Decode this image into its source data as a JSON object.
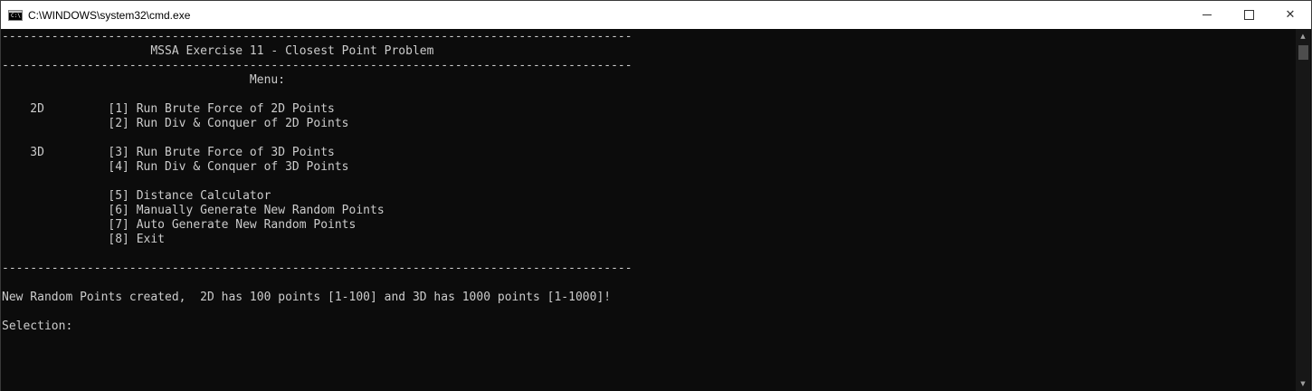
{
  "window": {
    "title": "C:\\WINDOWS\\system32\\cmd.exe",
    "icon": "cmd-icon",
    "controls": {
      "minimize_icon": "minimize-icon",
      "maximize_icon": "maximize-icon",
      "close_label": "✕"
    }
  },
  "console": {
    "lines": [
      "-----------------------------------------------------------------------------------------",
      "                     MSSA Exercise 11 - Closest Point Problem",
      "-----------------------------------------------------------------------------------------",
      "                                   Menu:",
      "",
      "    2D         [1] Run Brute Force of 2D Points",
      "               [2] Run Div & Conquer of 2D Points",
      "",
      "    3D         [3] Run Brute Force of 3D Points",
      "               [4] Run Div & Conquer of 3D Points",
      "",
      "               [5] Distance Calculator",
      "               [6] Manually Generate New Random Points",
      "               [7] Auto Generate New Random Points",
      "               [8] Exit",
      "",
      "-----------------------------------------------------------------------------------------",
      "",
      "New Random Points created,  2D has 100 points [1-100] and 3D has 1000 points [1-1000]!",
      "",
      "Selection: "
    ]
  },
  "colors": {
    "console_bg": "#0c0c0c",
    "console_fg": "#cccccc",
    "titlebar_bg": "#ffffff"
  }
}
